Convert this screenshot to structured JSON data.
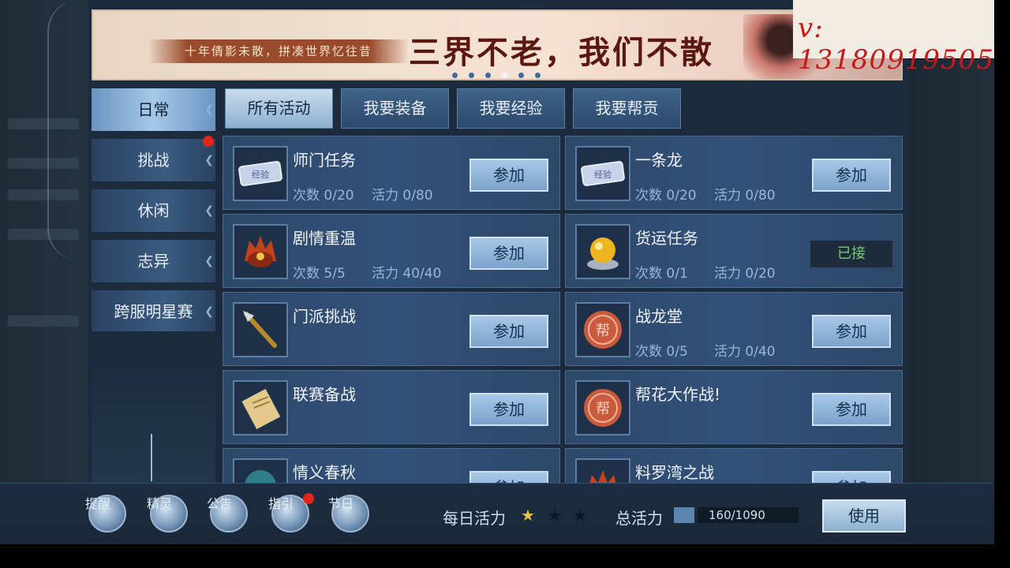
{
  "banner": {
    "subtitle": "十年倩影未散，拼凑世界忆往昔",
    "slogan": "三界不老，我们不散",
    "page_dots": 6,
    "active_dot": 3
  },
  "watermark": "v: 13180919505",
  "sidebar": {
    "items": [
      {
        "label": "日常",
        "active": true
      },
      {
        "label": "挑战",
        "badge": true
      },
      {
        "label": "休闲"
      },
      {
        "label": "志异"
      },
      {
        "label": "跨服明星赛"
      }
    ]
  },
  "tabs": [
    "所有活动",
    "我要装备",
    "我要经验",
    "我要帮贡"
  ],
  "activities": [
    {
      "name": "师门任务",
      "count": "次数 0/20",
      "vitality": "活力 0/80",
      "action": "参加",
      "icon": "exp-ticket-icon"
    },
    {
      "name": "一条龙",
      "count": "次数 0/20",
      "vitality": "活力 0/80",
      "action": "参加",
      "icon": "exp-ticket-icon"
    },
    {
      "name": "剧情重温",
      "count": "次数 5/5",
      "vitality": "活力 40/40",
      "action": "参加",
      "icon": "helmet-icon"
    },
    {
      "name": "货运任务",
      "count": "次数 0/1",
      "vitality": "活力 0/20",
      "action": "已接",
      "icon": "golden-orb-icon"
    },
    {
      "name": "门派挑战",
      "count": "",
      "vitality": "",
      "action": "参加",
      "icon": "spear-icon"
    },
    {
      "name": "战龙堂",
      "count": "次数 0/5",
      "vitality": "活力 0/40",
      "action": "参加",
      "icon": "guild-coin-icon"
    },
    {
      "name": "联赛备战",
      "count": "",
      "vitality": "",
      "action": "参加",
      "icon": "scroll-icon"
    },
    {
      "name": "帮花大作战!",
      "count": "",
      "vitality": "",
      "action": "参加",
      "icon": "guild-coin-icon"
    },
    {
      "name": "情义春秋",
      "count": "",
      "vitality": "",
      "action": "参加",
      "icon": "emblem-icon"
    },
    {
      "name": "料罗湾之战",
      "count": "",
      "vitality": "",
      "action": "参加",
      "icon": "helmet-icon"
    }
  ],
  "bottom_bar": {
    "icons": [
      {
        "label": "提醒",
        "icon": "book-icon",
        "badge": false
      },
      {
        "label": "精灵",
        "icon": "fairy-icon",
        "badge": false
      },
      {
        "label": "公告",
        "icon": "horn-icon",
        "badge": false
      },
      {
        "label": "指引",
        "icon": "guide-book-icon",
        "badge": true
      },
      {
        "label": "节日",
        "icon": "festival-icon",
        "badge": false
      }
    ],
    "daily_label": "每日活力",
    "stars_total": 3,
    "stars_filled": 0.5,
    "total_label": "总活力",
    "total_value": "160/1090",
    "use_label": "使用"
  },
  "colors": {
    "panel": "#1b2a3c",
    "card": "#33507a",
    "button": "#a9c8e6",
    "accepted_text": "#6fd06a",
    "badge_red": "#e0261d",
    "watermark_red": "#c41a1a"
  }
}
